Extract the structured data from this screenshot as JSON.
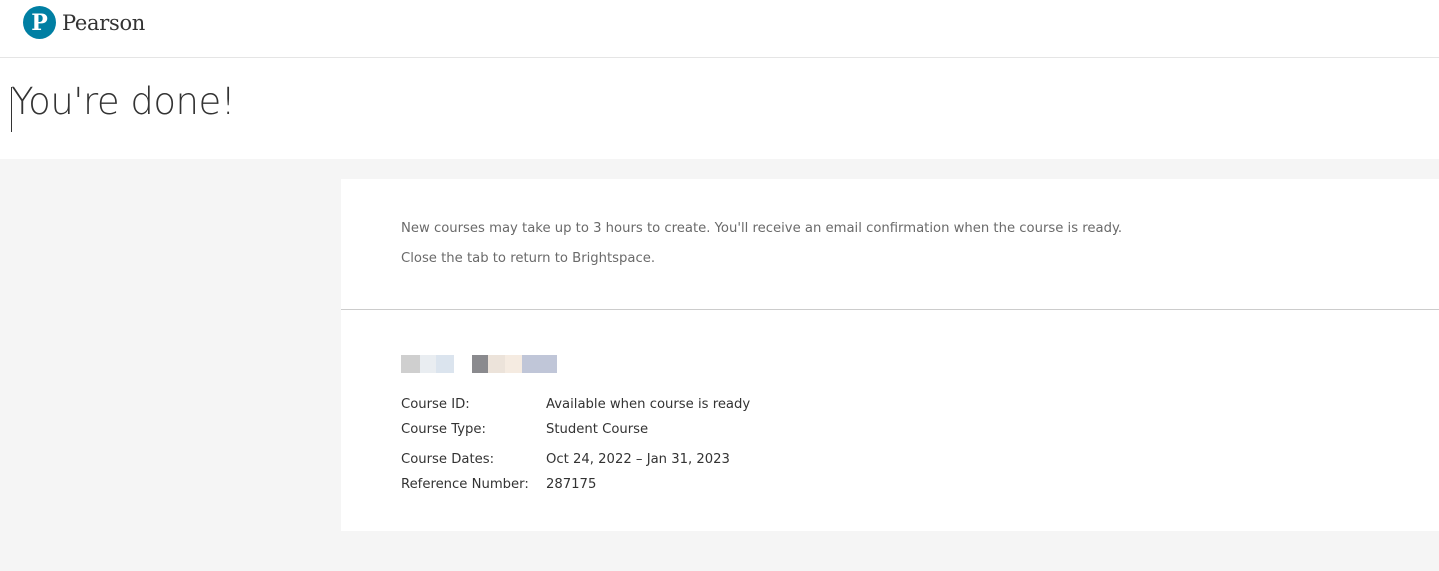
{
  "header": {
    "logo_letter": "P",
    "logo_text": "Pearson",
    "logo_color": "#007fa3"
  },
  "page": {
    "title": "You're done!"
  },
  "card": {
    "message_1": "New courses may take up to 3 hours to create. You'll receive an email confirmation when the course is ready.",
    "message_2": "Close the tab to return to Brightspace.",
    "details": [
      {
        "label": "Course ID:",
        "value": "Available when course is ready"
      },
      {
        "label": "Course Type:",
        "value": "Student Course"
      },
      {
        "label": "Course Dates:",
        "value": "Oct 24, 2022 – Jan 31, 2023"
      },
      {
        "label": "Reference Number:",
        "value": "287175"
      }
    ]
  },
  "colors": {
    "background": "#f5f5f5",
    "card": "#ffffff",
    "text": "#333333",
    "muted_text": "#6a6a6a",
    "divider": "#cccccc"
  }
}
